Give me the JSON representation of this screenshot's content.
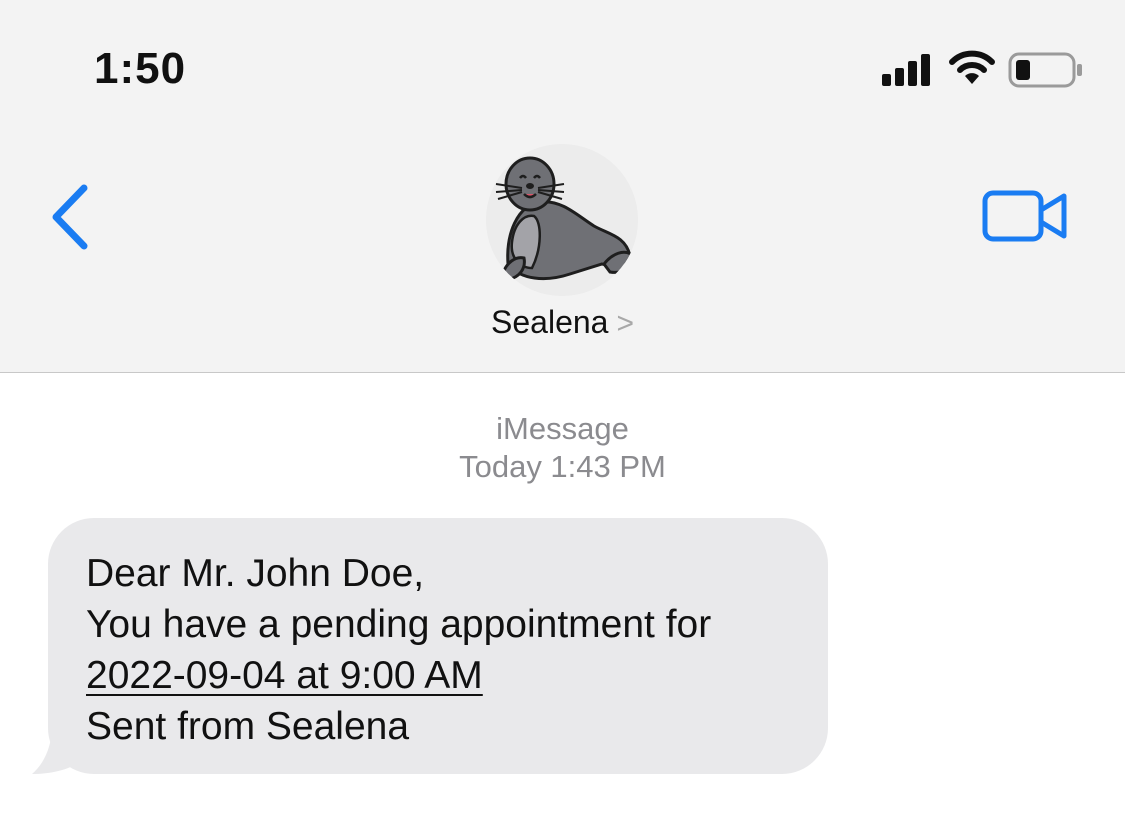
{
  "status_bar": {
    "time": "1:50",
    "icons": [
      "cellular-signal-icon",
      "wifi-icon",
      "battery-icon"
    ]
  },
  "nav": {
    "back_icon": "chevron-left-icon",
    "video_icon": "video-camera-icon",
    "contact_name": "Sealena",
    "contact_chevron": ">",
    "avatar": "seal-avatar"
  },
  "conversation": {
    "service_label": "iMessage",
    "timestamp": "Today 1:43 PM",
    "message": {
      "line1": "Dear Mr. John Doe,",
      "line2": "You have a pending appointment for",
      "date_link": "2022-09-04 at 9:00 AM",
      "line4": "Sent from Sealena"
    }
  },
  "colors": {
    "accent": "#1a7cf2",
    "header_bg": "#f3f3f3",
    "bubble_bg": "#e9e9eb",
    "meta_text": "#8b8b8f"
  }
}
